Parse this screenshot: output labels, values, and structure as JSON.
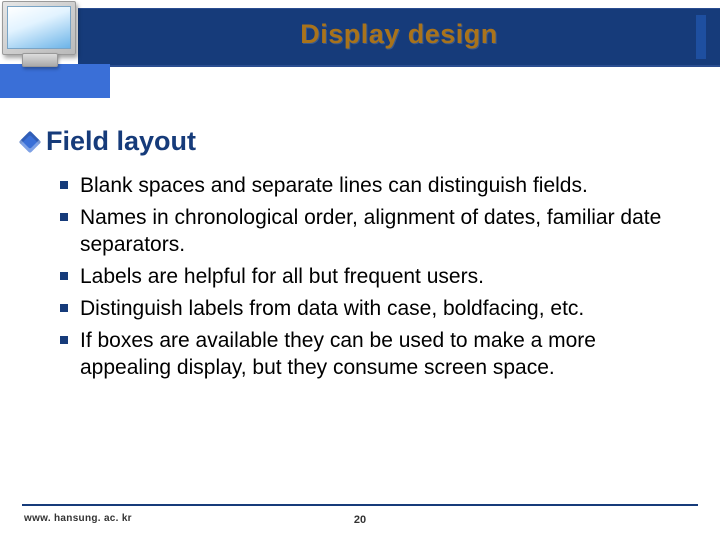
{
  "slide": {
    "title": "Display design",
    "section": {
      "label": "Field layout"
    },
    "bullets": [
      "Blank spaces and separate lines can distinguish fields.",
      "Names in chronological order, alignment of dates, familiar date separators.",
      "Labels are helpful for all but frequent users.",
      "Distinguish labels from data with case, boldfacing, etc.",
      "If boxes are available they can be used to make a more appealing display, but they consume screen space."
    ],
    "footer": {
      "url": "www. hansung. ac. kr",
      "page": "20"
    }
  }
}
